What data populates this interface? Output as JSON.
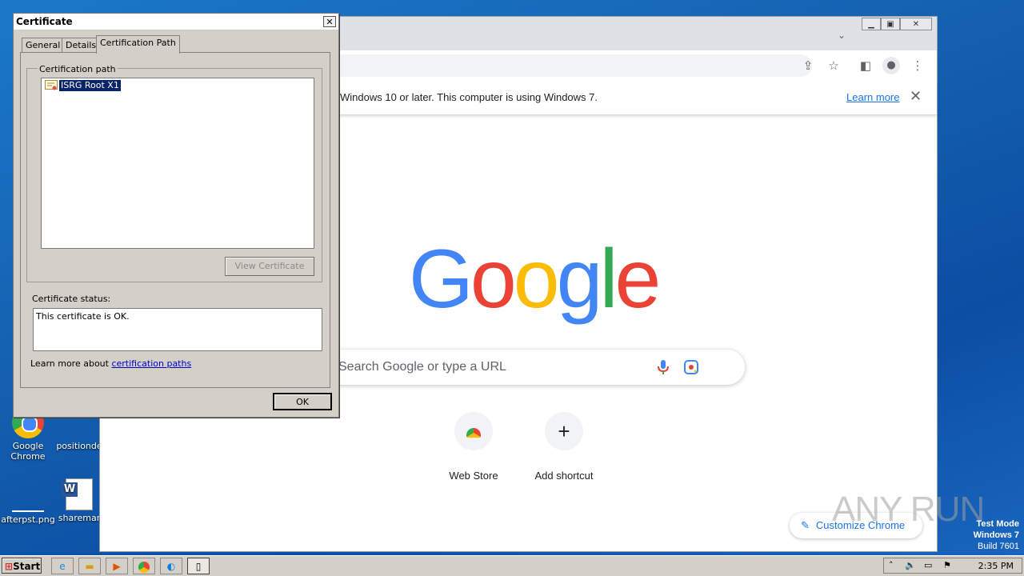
{
  "desktop": {
    "icons": [
      {
        "label": "Google Chrome"
      },
      {
        "label": "positionde"
      },
      {
        "label": "afterpst.png"
      },
      {
        "label": "sharemar"
      }
    ]
  },
  "chrome": {
    "infobar_text": "Windows 10 or later. This computer is using Windows 7.",
    "learn_more": "Learn more",
    "search_placeholder": "Search Google or type a URL",
    "shortcuts": [
      {
        "label": "Web Store"
      },
      {
        "label": "Add shortcut"
      }
    ],
    "customize_label": "Customize Chrome"
  },
  "dialog": {
    "title": "Certificate",
    "tabs": [
      {
        "label": "General"
      },
      {
        "label": "Details"
      },
      {
        "label": "Certification Path"
      }
    ],
    "group_label": "Certification path",
    "tree_item": "ISRG Root X1",
    "view_cert_button": "View Certificate",
    "status_label": "Certificate status:",
    "status_text": "This certificate is OK.",
    "learn_prefix": "Learn more about ",
    "learn_link": "certification paths",
    "ok_button": "OK"
  },
  "taskbar": {
    "start_label": "Start",
    "clock": "2:35 PM"
  },
  "watermark": {
    "line1": "Test Mode",
    "line2": "Windows 7",
    "line3": "Build 7601",
    "brand": "ANY RUN"
  },
  "colors": {
    "google_blue": "#4285f4",
    "google_red": "#ea4335",
    "google_yellow": "#fbbc05",
    "google_green": "#34a853",
    "selection": "#0a246a"
  }
}
